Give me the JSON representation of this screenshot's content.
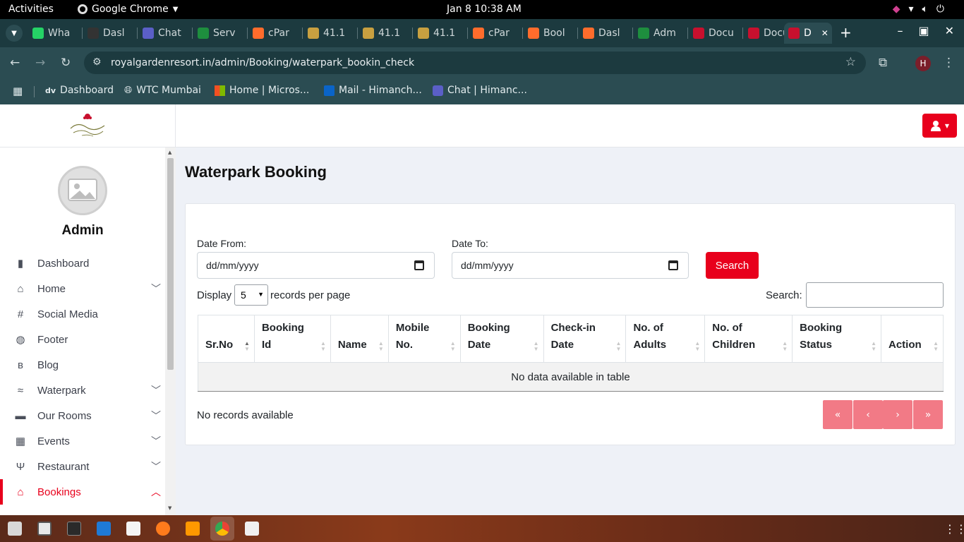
{
  "os": {
    "activities": "Activities",
    "app_name": "Google Chrome",
    "clock": "Jan 8  10:38 AM"
  },
  "tabs": [
    {
      "label": "Wha",
      "color": "#25d366"
    },
    {
      "label": "Dasl",
      "color": "#333333"
    },
    {
      "label": "Chat",
      "color": "#5b5fc7"
    },
    {
      "label": "Serv",
      "color": "#1e8e3e"
    },
    {
      "label": "cPar",
      "color": "#ff6c2c"
    },
    {
      "label": "41.1",
      "color": "#c8a040"
    },
    {
      "label": "41.1",
      "color": "#c8a040"
    },
    {
      "label": "41.1",
      "color": "#c8a040"
    },
    {
      "label": "cPar",
      "color": "#ff6c2c"
    },
    {
      "label": "Bool",
      "color": "#ff6c2c"
    },
    {
      "label": "Dasl",
      "color": "#ff6c2c"
    },
    {
      "label": "Adm",
      "color": "#1e8e3e"
    },
    {
      "label": "Docu",
      "color": "#c8102e"
    },
    {
      "label": "Docu",
      "color": "#c8102e"
    },
    {
      "label": "D",
      "color": "#c8102e"
    }
  ],
  "address_bar": {
    "url": "royalgardenresort.in/admin/Booking/waterpark_bookin_check",
    "profile_initial": "H"
  },
  "bookmarks": [
    {
      "label": "Dashboard"
    },
    {
      "label": "WTC Mumbai"
    },
    {
      "label": "Home | Micros..."
    },
    {
      "label": "Mail - Himanch..."
    },
    {
      "label": "Chat | Himanc..."
    }
  ],
  "sidebar": {
    "user_name": "Admin",
    "items": [
      {
        "label": "Dashboard",
        "icon": "bar-chart-icon",
        "has_submenu": false
      },
      {
        "label": "Home",
        "icon": "home-icon",
        "has_submenu": true
      },
      {
        "label": "Social Media",
        "icon": "hashtag-icon",
        "has_submenu": false
      },
      {
        "label": "Footer",
        "icon": "globe-icon",
        "has_submenu": false
      },
      {
        "label": "Blog",
        "icon": "blog-icon",
        "has_submenu": false
      },
      {
        "label": "Waterpark",
        "icon": "swimming-icon",
        "has_submenu": true
      },
      {
        "label": "Our Rooms",
        "icon": "bed-icon",
        "has_submenu": true
      },
      {
        "label": "Events",
        "icon": "calendar-icon",
        "has_submenu": true
      },
      {
        "label": "Restaurant",
        "icon": "utensils-icon",
        "has_submenu": true
      },
      {
        "label": "Bookings",
        "icon": "home-icon",
        "has_submenu": true,
        "active": true
      }
    ]
  },
  "main": {
    "title": "Waterpark Booking",
    "date_from_label": "Date From:",
    "date_to_label": "Date To:",
    "date_placeholder": "dd/mm/yyyy",
    "search_button": "Search",
    "display_label": "Display",
    "records_per_page": "5",
    "records_per_page_suffix": "records per page",
    "search_label": "Search:",
    "search_value": "",
    "columns": [
      [
        "Sr.No"
      ],
      [
        "Booking",
        "Id"
      ],
      [
        "Name"
      ],
      [
        "Mobile",
        "No."
      ],
      [
        "Booking",
        "Date"
      ],
      [
        "Check-in",
        "Date"
      ],
      [
        "No. of",
        "Adults"
      ],
      [
        "No. of",
        "Children"
      ],
      [
        "Booking",
        "Status"
      ],
      [
        "Action"
      ]
    ],
    "empty_message": "No data available in table",
    "records_info": "No records available",
    "pagination": [
      "«",
      "‹",
      "›",
      "»"
    ]
  },
  "colors": {
    "accent": "#e8001c",
    "page_bg": "#eef1f7",
    "chrome_tabstrip": "#1c3a3f",
    "chrome_toolbar": "#2b4c52"
  }
}
